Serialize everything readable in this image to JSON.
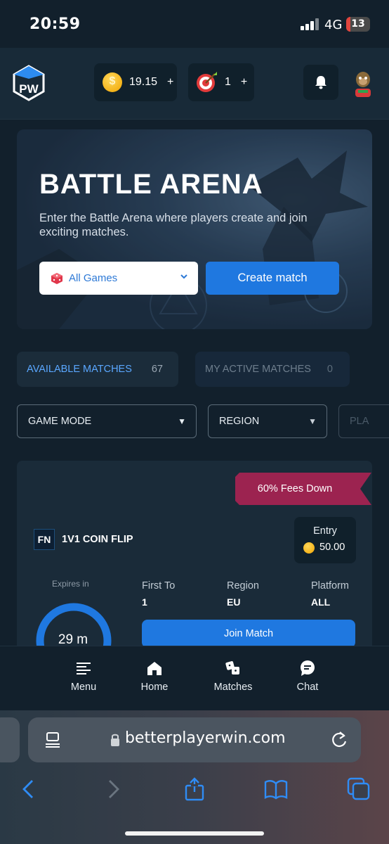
{
  "status_bar": {
    "time": "20:59",
    "network": "4G",
    "battery": "13"
  },
  "header": {
    "logo_alt": "PW",
    "coins": {
      "value": "19.15",
      "plus": "+"
    },
    "targets": {
      "value": "1",
      "plus": "+"
    }
  },
  "hero": {
    "title": "BATTLE ARENA",
    "subtitle": "Enter the Battle Arena where players create and join exciting matches.",
    "game_select": "All Games",
    "create_button": "Create match"
  },
  "tabs": [
    {
      "label": "AVAILABLE MATCHES",
      "count": "67"
    },
    {
      "label": "MY ACTIVE MATCHES",
      "count": "0"
    }
  ],
  "filters": {
    "game_mode": "GAME MODE",
    "region": "REGION",
    "platform": "PLA"
  },
  "match": {
    "ribbon": "60% Fees Down",
    "game_logo": "FN",
    "game_name": "1V1 COIN FLIP",
    "entry_label": "Entry",
    "entry_value": "50.00",
    "expires_label": "Expires in",
    "expires_value": "29 m",
    "first_to_label": "First To",
    "first_to_value": "1",
    "region_label": "Region",
    "region_value": "EU",
    "platform_label": "Platform",
    "platform_value": "ALL",
    "join_button": "Join Match"
  },
  "bottom_nav": [
    {
      "label": "Menu"
    },
    {
      "label": "Home"
    },
    {
      "label": "Matches"
    },
    {
      "label": "Chat"
    }
  ],
  "browser": {
    "url": "betterplayerwin.com"
  },
  "colors": {
    "accent": "#1f78e0",
    "ribbon": "#9c2350",
    "background": "#12202c",
    "card": "#1a2b39"
  }
}
